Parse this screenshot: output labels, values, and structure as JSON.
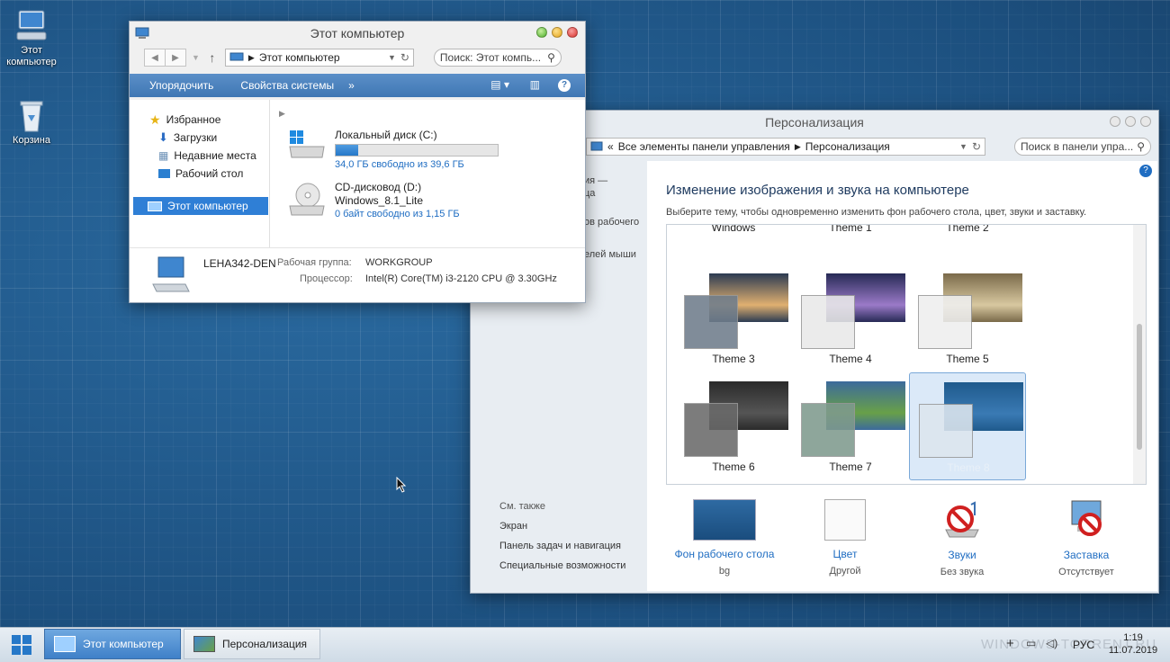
{
  "desktop": {
    "icons": [
      {
        "label": "Этот компьютер"
      },
      {
        "label": "Корзина"
      }
    ]
  },
  "explorer": {
    "title": "Этот компьютер",
    "address": "Этот компьютер",
    "search_placeholder": "Поиск: Этот компь...",
    "ribbon": {
      "organize": "Упорядочить",
      "system_props": "Свойства системы",
      "more": "»"
    },
    "sidebar": {
      "favorites": "Избранное",
      "items": [
        "Загрузки",
        "Недавние места",
        "Рабочий стол"
      ],
      "this_pc": "Этот компьютер"
    },
    "drives": [
      {
        "name": "Локальный диск (C:)",
        "free": "34,0 ГБ свободно из 39,6 ГБ",
        "used_fraction": 0.14
      },
      {
        "name": "CD-дисковод (D:)",
        "label": "Windows_8.1_Lite",
        "free": "0 байт свободно из 1,15 ГБ"
      }
    ],
    "details": {
      "computer_name": "LEHA342-DEN",
      "workgroup_label": "Рабочая группа:",
      "workgroup": "WORKGROUP",
      "cpu_label": "Процессор:",
      "cpu": "Intel(R) Core(TM) i3-2120 CPU @ 3.30GHz"
    }
  },
  "personalization": {
    "title": "Персонализация",
    "breadcrumb": {
      "sep": "«",
      "root": "Все элементы панели управления",
      "current": "Персонализация"
    },
    "search_placeholder": "Поиск в панели упра...",
    "left_fragments": [
      "ия —",
      "ца",
      "ов рабочего",
      "елей мыши"
    ],
    "heading": "Изменение изображения и звука на компьютере",
    "subheading": "Выберите тему, чтобы одновременно изменить фон рабочего стола, цвет, звуки и заставку.",
    "partial_labels": [
      "Windows",
      "Theme 1",
      "Theme 2"
    ],
    "themes": [
      {
        "name": "Theme 3",
        "bg": "#2b3b52",
        "accent": "#e0b070",
        "swatch": "#6f7d8c"
      },
      {
        "name": "Theme 4",
        "bg": "#262a55",
        "accent": "#9b7ac8",
        "swatch": "#e9e9e9"
      },
      {
        "name": "Theme 5",
        "bg": "#7a6a4a",
        "accent": "#d8c8a0",
        "swatch": "#efefef"
      },
      {
        "name": "Theme 6",
        "bg": "#2a2a2a",
        "accent": "#555555",
        "swatch": "#6a6a6a"
      },
      {
        "name": "Theme 7",
        "bg": "#3c6a9c",
        "accent": "#68a048",
        "swatch": "#7f9a8e"
      },
      {
        "name": "Theme 8",
        "bg": "#1f5a8c",
        "accent": "#3a7ab4",
        "swatch": "#dde6ee"
      }
    ],
    "see_also": {
      "title": "См. также",
      "items": [
        "Экран",
        "Панель задач и навигация",
        "Специальные возможности"
      ]
    },
    "bottom": [
      {
        "label": "Фон рабочего стола",
        "value": "bg"
      },
      {
        "label": "Цвет",
        "value": "Другой"
      },
      {
        "label": "Звуки",
        "value": "Без звука"
      },
      {
        "label": "Заставка",
        "value": "Отсутствует"
      }
    ]
  },
  "taskbar": {
    "buttons": [
      "Этот компьютер",
      "Персонализация"
    ],
    "lang": "РУС",
    "time": "1:19",
    "date": "11.07.2019",
    "watermark": "WINDOWS-TORRENT.RU"
  }
}
